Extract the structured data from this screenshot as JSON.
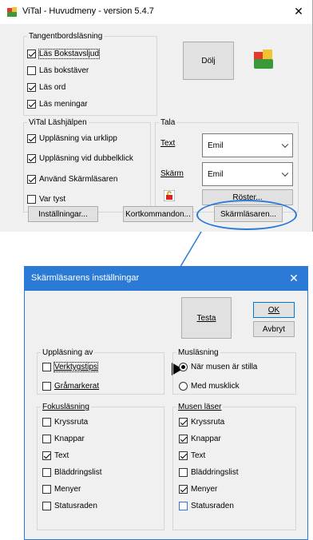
{
  "main": {
    "title": "ViTal - Huvudmeny - version 5.4.7",
    "close": "✕",
    "tangent": {
      "legend": "Tangentbordsläsning",
      "items": [
        {
          "label": "Läs Bokstavsljud",
          "checked": true
        },
        {
          "label": "Läs bokstäver",
          "checked": false
        },
        {
          "label": "Läs ord",
          "checked": true
        },
        {
          "label": "Läs meningar",
          "checked": true
        }
      ]
    },
    "hide_button": "Dölj",
    "lashjalpen": {
      "legend": "ViTal Läshjälpen",
      "items": [
        {
          "label": "Uppläsning via urklipp",
          "checked": true
        },
        {
          "label": "Uppläsning vid dubbelklick",
          "checked": true
        },
        {
          "label": "Använd Skärmläsaren",
          "checked": true
        },
        {
          "label": "Var tyst",
          "checked": false
        }
      ]
    },
    "tala": {
      "legend": "Tala",
      "text_label": "Text",
      "text_voice": "Emil",
      "screen_label": "Skärm",
      "screen_voice": "Emil",
      "voices_button": "Röster..."
    },
    "buttons": {
      "settings": "Inställningar...",
      "shortcuts": "Kortkommandon...",
      "screenreader": "Skärmläsaren..."
    }
  },
  "dialog": {
    "title": "Skärmläsarens inställningar",
    "close": "✕",
    "test_button": "Testa",
    "ok_button": "OK",
    "cancel_button": "Avbryt",
    "upplasning": {
      "legend": "Uppläsning av",
      "items": [
        {
          "label": "Verktygstips",
          "checked": false
        },
        {
          "label": "Gråmarkerat",
          "checked": false
        }
      ]
    },
    "muslasning": {
      "legend": "Musläsning",
      "items": [
        {
          "label": "När musen är stilla",
          "selected": true
        },
        {
          "label": "Med musklick",
          "selected": false
        }
      ]
    },
    "fokus": {
      "legend": "Fokusläsning",
      "items": [
        {
          "label": "Kryssruta",
          "checked": false
        },
        {
          "label": "Knappar",
          "checked": false
        },
        {
          "label": "Text",
          "checked": true
        },
        {
          "label": "Bläddringslist",
          "checked": false
        },
        {
          "label": "Menyer",
          "checked": false
        },
        {
          "label": "Statusraden",
          "checked": false
        }
      ]
    },
    "musen": {
      "legend": "Musen läser",
      "items": [
        {
          "label": "Kryssruta",
          "checked": true
        },
        {
          "label": "Knappar",
          "checked": true
        },
        {
          "label": "Text",
          "checked": true
        },
        {
          "label": "Bläddringslist",
          "checked": false
        },
        {
          "label": "Menyer",
          "checked": true
        },
        {
          "label": "Statusraden",
          "checked": false
        }
      ]
    }
  }
}
